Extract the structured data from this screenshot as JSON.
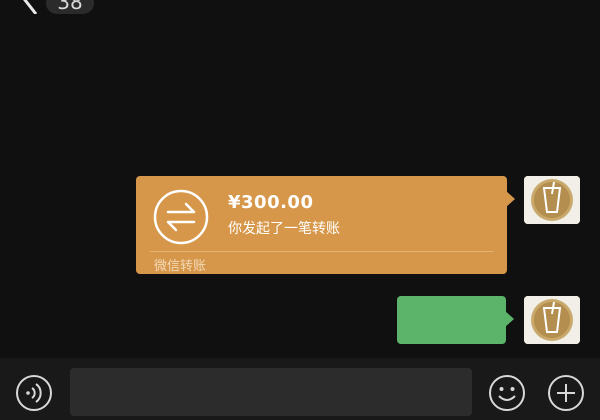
{
  "header": {
    "unread_count": "38"
  },
  "messages": [
    {
      "type": "transfer",
      "amount": "¥300.00",
      "description": "你发起了一笔转账",
      "footer": "微信转账"
    },
    {
      "type": "text",
      "text": ""
    }
  ],
  "input": {
    "value": "",
    "placeholder": ""
  },
  "icons": {
    "back": "chevron-left-icon",
    "more": "more-dots-icon",
    "transfer": "transfer-arrows-icon",
    "voice": "voice-icon",
    "emoji": "emoji-icon",
    "plus": "plus-icon"
  },
  "colors": {
    "background": "#101010",
    "transfer_card": "#d7974a",
    "outgoing_bubble": "#5cb46a",
    "input_bar": "#191919"
  }
}
